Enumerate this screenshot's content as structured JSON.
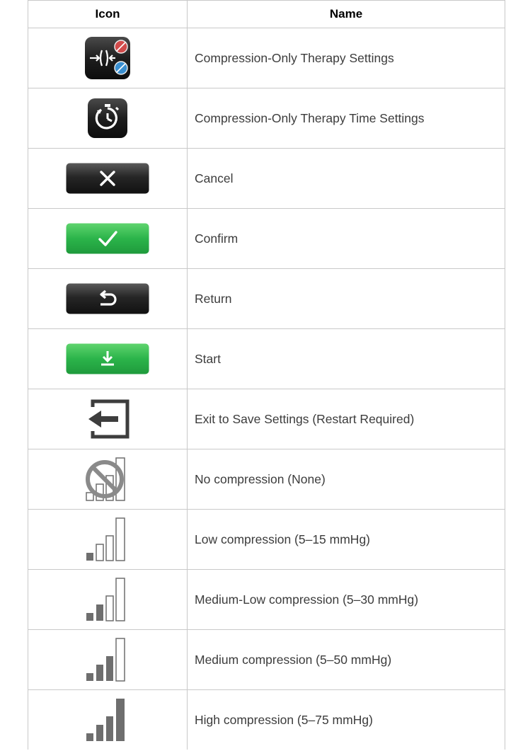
{
  "table": {
    "headers": {
      "icon": "Icon",
      "name": "Name"
    },
    "rows": [
      {
        "icon": "compression-therapy-settings-icon",
        "name": "Compression-Only Therapy Settings"
      },
      {
        "icon": "stopwatch-time-settings-icon",
        "name": "Compression-Only Therapy Time Settings"
      },
      {
        "icon": "cancel-x-icon",
        "name": "Cancel"
      },
      {
        "icon": "confirm-check-icon",
        "name": "Confirm"
      },
      {
        "icon": "return-arrow-icon",
        "name": "Return"
      },
      {
        "icon": "start-download-icon",
        "name": "Start"
      },
      {
        "icon": "exit-door-arrow-icon",
        "name": "Exit to Save Settings (Restart Required)"
      },
      {
        "icon": "no-compression-bars-icon",
        "name": "No compression (None)",
        "filled_bars": 0
      },
      {
        "icon": "low-compression-bars-icon",
        "name": "Low compression (5–15 mmHg)",
        "filled_bars": 1
      },
      {
        "icon": "medium-low-compression-bars-icon",
        "name": "Medium-Low compression (5–30 mmHg)",
        "filled_bars": 2
      },
      {
        "icon": "medium-compression-bars-icon",
        "name": "Medium compression (5–50 mmHg)",
        "filled_bars": 3
      },
      {
        "icon": "high-compression-bars-icon",
        "name": "High compression (5–75 mmHg)",
        "filled_bars": 4
      }
    ]
  },
  "colors": {
    "button_dark": "#1c1c1c",
    "button_green": "#2ab34a",
    "bar_filled": "#6e6e6e",
    "prohibit_gray": "#8a8a8a",
    "border": "#c9c9c9"
  }
}
